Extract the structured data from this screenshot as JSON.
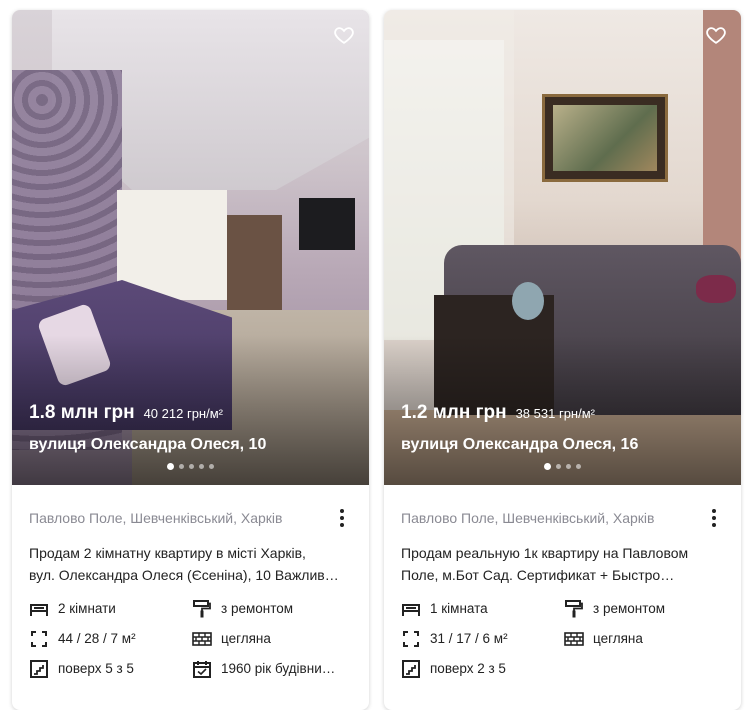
{
  "listings": [
    {
      "price": "1.8 млн грн",
      "price_per_m2": "40 212 грн/м²",
      "address": "вулиця Олександра Олеся, 10",
      "location": "Павлово Поле, Шевченківський, Харків",
      "description_line1": "Продам 2 кімнатну квартиру в місті Харків,",
      "description_line2": "вул. Олександра Олеся (Єсеніна), 10 Важлив…",
      "rooms": "2 кімнати",
      "renovation": "з ремонтом",
      "area": "44 / 28 / 7 м²",
      "wall_type": "цегляна",
      "floor": "поверх 5 з 5",
      "year": "1960 рік будівни…",
      "photo_dots": 5,
      "active_dot": 0
    },
    {
      "price": "1.2 млн грн",
      "price_per_m2": "38 531 грн/м²",
      "address": "вулиця Олександра Олеся, 16",
      "location": "Павлово Поле, Шевченківський, Харків",
      "description_line1": "Продам реальную 1к квартиру на Павловом",
      "description_line2": "Поле, м.Бот Сад. Сертификат + Быстро…",
      "rooms": "1 кімната",
      "renovation": "з ремонтом",
      "area": "31 / 17 / 6 м²",
      "wall_type": "цегляна",
      "floor": "поверх 2 з 5",
      "photo_dots": 4,
      "active_dot": 0
    }
  ],
  "icons": {
    "favorite": "heart-outline-icon",
    "more": "more-vertical-icon",
    "rooms": "bed-icon",
    "renovation": "paint-roller-icon",
    "area": "area-frame-icon",
    "wall": "brick-wall-icon",
    "floor": "stairs-icon",
    "year": "calendar-icon"
  }
}
